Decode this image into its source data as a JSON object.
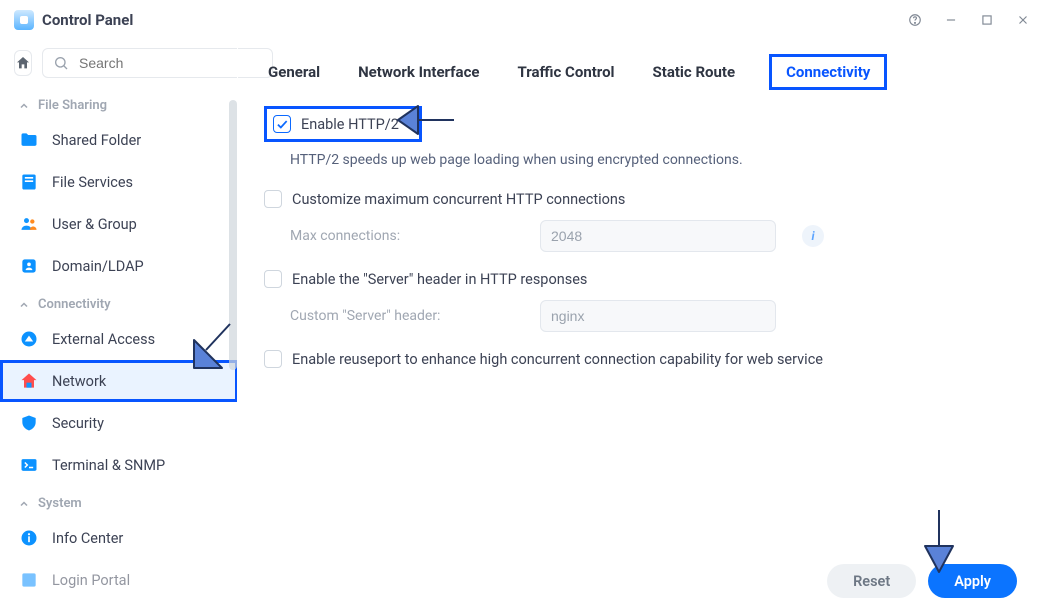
{
  "window": {
    "title": "Control Panel"
  },
  "search": {
    "placeholder": "Search"
  },
  "sections": {
    "file_sharing": {
      "label": "File Sharing"
    },
    "connectivity": {
      "label": "Connectivity"
    },
    "system": {
      "label": "System"
    }
  },
  "sidebar": {
    "shared_folder": "Shared Folder",
    "file_services": "File Services",
    "user_group": "User & Group",
    "domain_ldap": "Domain/LDAP",
    "external_access": "External Access",
    "network": "Network",
    "security": "Security",
    "terminal_snmp": "Terminal & SNMP",
    "info_center": "Info Center",
    "login_portal": "Login Portal"
  },
  "tabs": {
    "general": "General",
    "network_interface": "Network Interface",
    "traffic_control": "Traffic Control",
    "static_route": "Static Route",
    "connectivity": "Connectivity"
  },
  "conn": {
    "enable_http2": "Enable HTTP/2",
    "http2_desc": "HTTP/2 speeds up web page loading when using encrypted connections.",
    "customize_max": "Customize maximum concurrent HTTP connections",
    "max_conn_label": "Max connections:",
    "max_conn_value": "2048",
    "enable_server_header": "Enable the \"Server\" header in HTTP responses",
    "custom_server_label": "Custom \"Server\" header:",
    "custom_server_value": "nginx",
    "enable_reuseport": "Enable reuseport to enhance high concurrent connection capability for web service"
  },
  "buttons": {
    "reset": "Reset",
    "apply": "Apply"
  }
}
